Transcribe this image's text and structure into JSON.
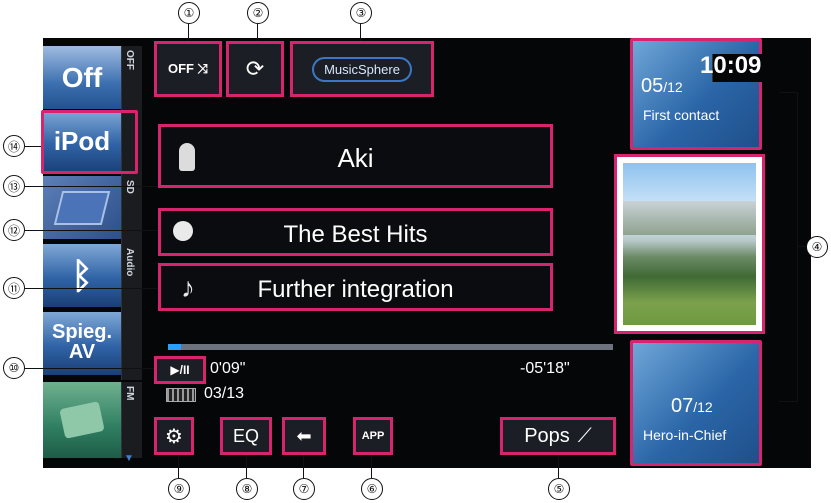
{
  "sources": [
    {
      "tile": "Off",
      "strip": "OFF"
    },
    {
      "tile": "iPod",
      "strip": ""
    },
    {
      "tile": "",
      "strip": "SD"
    },
    {
      "tile": "",
      "strip": "Audio"
    },
    {
      "tile": "Spieg. AV",
      "strip": ""
    },
    {
      "tile": "",
      "strip": "FM"
    }
  ],
  "top_buttons": {
    "shuffle": "OFF ⤨",
    "repeat_icon": "repeat-icon",
    "musicsphere": "MusicSphere"
  },
  "tracks": {
    "artist": "Aki",
    "album": "The Best Hits",
    "song": "Further integration"
  },
  "playback": {
    "elapsed": "0'09\"",
    "remaining": "-05'18\"",
    "track_count": "03/13",
    "play_pause": "▶/II",
    "progress": 0.03
  },
  "bottom_buttons": {
    "settings_icon": "gear-icon",
    "eq": "EQ",
    "back_icon": "back-icon",
    "app_label": "APP",
    "pops": "Pops"
  },
  "right_panel": {
    "clock": "10:09",
    "prev_track": {
      "number": "05",
      "total": "/12",
      "title": "First contact"
    },
    "next_track": {
      "number": "07",
      "total": "/12",
      "title": "Hero-in-Chief"
    }
  },
  "callouts": [
    "①",
    "②",
    "③",
    "④",
    "⑤",
    "⑥",
    "⑦",
    "⑧",
    "⑨",
    "⑩",
    "⑪",
    "⑫",
    "⑬",
    "⑭"
  ]
}
